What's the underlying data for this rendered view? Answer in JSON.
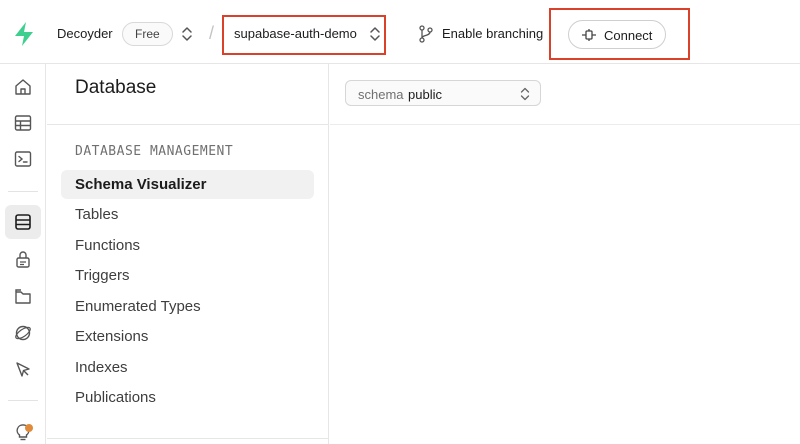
{
  "topbar": {
    "org_name": "Decoyder",
    "plan_badge": "Free",
    "separator": "/",
    "project_name": "supabase-auth-demo",
    "branching_label": "Enable branching",
    "connect_label": "Connect"
  },
  "rail": {
    "items": [
      {
        "icon": "home-icon",
        "active": false
      },
      {
        "icon": "table-editor-icon",
        "active": false
      },
      {
        "icon": "sql-editor-icon",
        "active": false
      },
      {
        "icon": "database-icon",
        "active": true
      },
      {
        "icon": "authentication-icon",
        "active": false
      },
      {
        "icon": "storage-icon",
        "active": false
      },
      {
        "icon": "realtime-icon",
        "active": false
      },
      {
        "icon": "cursor-icon",
        "active": false
      },
      {
        "icon": "lightbulb-icon",
        "active": false
      }
    ]
  },
  "sidebar": {
    "title": "Database",
    "section_label": "DATABASE MANAGEMENT",
    "items": [
      {
        "label": "Schema Visualizer",
        "active": true
      },
      {
        "label": "Tables",
        "active": false
      },
      {
        "label": "Functions",
        "active": false
      },
      {
        "label": "Triggers",
        "active": false
      },
      {
        "label": "Enumerated Types",
        "active": false
      },
      {
        "label": "Extensions",
        "active": false
      },
      {
        "label": "Indexes",
        "active": false
      },
      {
        "label": "Publications",
        "active": false
      }
    ]
  },
  "main": {
    "schema_label": "schema",
    "schema_value": "public"
  },
  "colors": {
    "brand_green": "#3ecf8e",
    "highlight_red": "#d9412b",
    "notification_dot": "#e08a3b"
  }
}
